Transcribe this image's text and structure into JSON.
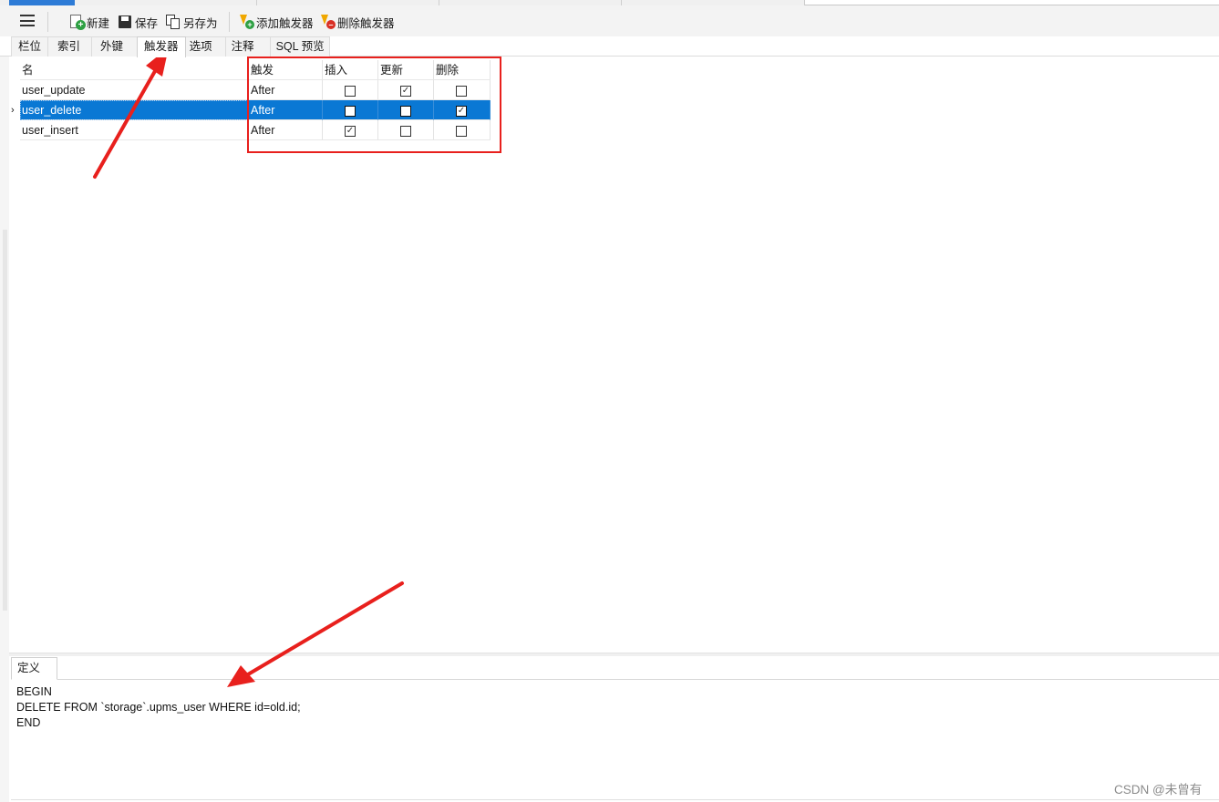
{
  "toolbar": {
    "new_label": "新建",
    "save_label": "保存",
    "save_as_label": "另存为",
    "add_trigger_label": "添加触发器",
    "delete_trigger_label": "删除触发器"
  },
  "tabs": [
    "栏位",
    "索引",
    "外键",
    "触发器",
    "选项",
    "注释",
    "SQL 预览"
  ],
  "active_tab": "触发器",
  "grid": {
    "columns": [
      "名",
      "触发",
      "插入",
      "更新",
      "删除"
    ],
    "rows": [
      {
        "name": "user_update",
        "fires": "After",
        "insert": false,
        "update": true,
        "delete": false,
        "selected": false
      },
      {
        "name": "user_delete",
        "fires": "After",
        "insert": false,
        "update": false,
        "delete": true,
        "selected": true
      },
      {
        "name": "user_insert",
        "fires": "After",
        "insert": true,
        "update": false,
        "delete": false,
        "selected": false
      }
    ]
  },
  "definition": {
    "tab_label": "定义",
    "code_lines": [
      "BEGIN",
      "DELETE FROM `storage`.upms_user WHERE id=old.id;",
      "END"
    ]
  },
  "watermark": "CSDN @未曾有",
  "colors": {
    "selection": "#0a78d4",
    "annotation": "#e8201d",
    "accent": "#2d7bd6"
  },
  "icons": [
    "menu-icon",
    "new-icon",
    "save-icon",
    "save-as-icon",
    "add-trigger-icon",
    "delete-trigger-icon",
    "check-icon"
  ]
}
